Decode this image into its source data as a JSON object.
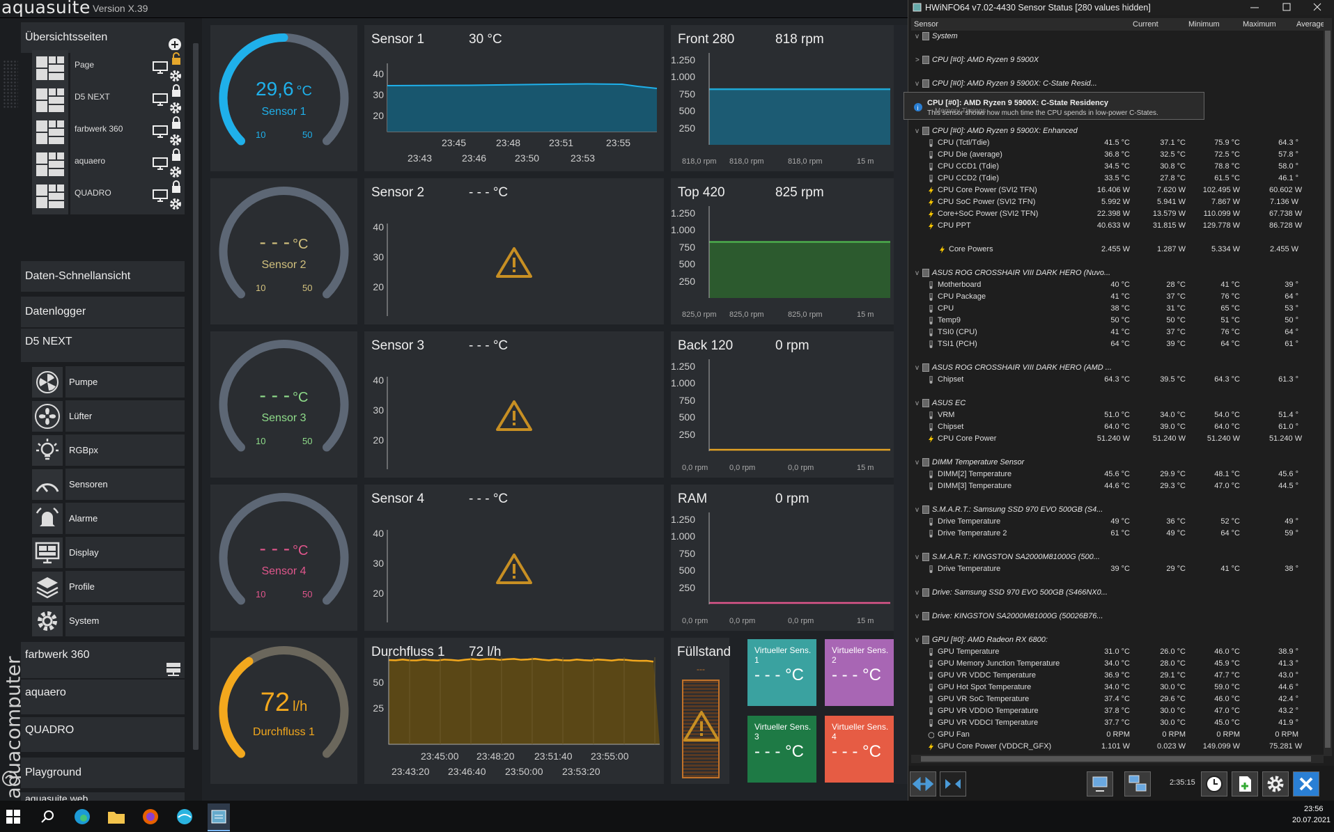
{
  "aquasuite": {
    "logo": "aquasuite",
    "version": "Version X.39",
    "brand_vertical": "aquacomputer",
    "sidebar": {
      "overview": "Übersichtsseiten",
      "pages": [
        {
          "label": "Page",
          "locked": false
        },
        {
          "label": "D5 NEXT",
          "locked": true
        },
        {
          "label": "farbwerk 360",
          "locked": true
        },
        {
          "label": "aquaero",
          "locked": true
        },
        {
          "label": "QUADRO",
          "locked": true
        }
      ],
      "data_quickview": "Daten-Schnellansicht",
      "datalogger": "Datenlogger",
      "d5next": "D5 NEXT",
      "d5_items": [
        "Pumpe",
        "Lüfter",
        "RGBpx",
        "Sensoren",
        "Alarme",
        "Display",
        "Profile",
        "System"
      ],
      "farbwerk": "farbwerk 360",
      "aquaero": "aquaero",
      "quadro": "QUADRO",
      "playground": "Playground",
      "aquasuite_web": "aquasuite web"
    },
    "gauges": [
      {
        "value": "29,6",
        "unit": "°C",
        "name": "Sensor 1",
        "min": "10",
        "max": "50",
        "color": "#1fb0ea",
        "fill": 0.5
      },
      {
        "value": "- - -",
        "unit": "°C",
        "name": "Sensor 2",
        "min": "10",
        "max": "50",
        "color": "#d1c07d",
        "fill": 0
      },
      {
        "value": "- - -",
        "unit": "°C",
        "name": "Sensor 3",
        "min": "10",
        "max": "50",
        "color": "#8fdc8a",
        "fill": 0
      },
      {
        "value": "- - -",
        "unit": "°C",
        "name": "Sensor 4",
        "min": "10",
        "max": "50",
        "color": "#e0568c",
        "fill": 0
      },
      {
        "value": "72",
        "unit": "l/h",
        "name": "Durchfluss 1",
        "color": "#f3a81d",
        "fill": 0.37
      }
    ],
    "temp_charts": [
      {
        "title": "Sensor 1",
        "value": "30 °C",
        "yticks": [
          "40",
          "30",
          "20"
        ],
        "xticks_top": [
          "23:45",
          "23:48",
          "23:51",
          "23:55"
        ],
        "xticks_bottom": [
          "23:43",
          "23:46",
          "23:50",
          "23:53"
        ],
        "has_data": true
      },
      {
        "title": "Sensor 2",
        "value": "- - - °C",
        "yticks": [
          "40",
          "30",
          "20"
        ],
        "has_data": false
      },
      {
        "title": "Sensor 3",
        "value": "- - - °C",
        "yticks": [
          "40",
          "30",
          "20"
        ],
        "has_data": false
      },
      {
        "title": "Sensor 4",
        "value": "- - - °C",
        "yticks": [
          "40",
          "30",
          "20"
        ],
        "has_data": false
      }
    ],
    "flow_chart": {
      "title": "Durchfluss 1",
      "value": "72 l/h",
      "yticks": [
        "50",
        "25"
      ],
      "xticks_top": [
        "23:45:00",
        "23:48:20",
        "23:51:40",
        "23:55:00"
      ],
      "xticks_bottom": [
        "23:43:20",
        "23:46:40",
        "23:50:00",
        "23:53:20"
      ]
    },
    "fan_charts": [
      {
        "title": "Front 280",
        "value": "818 rpm",
        "yticks": [
          "1.250",
          "1.000",
          "750",
          "500",
          "250"
        ],
        "footer": [
          "818,0 rpm",
          "818,0 rpm",
          "818,0 rpm",
          "15 m"
        ],
        "level": 818,
        "color": "#1fa8d6"
      },
      {
        "title": "Top 420",
        "value": "825 rpm",
        "yticks": [
          "1.250",
          "1.000",
          "750",
          "500",
          "250"
        ],
        "footer": [
          "825,0 rpm",
          "825,0 rpm",
          "825,0 rpm",
          "15 m"
        ],
        "level": 825,
        "color": "#4cae4c"
      },
      {
        "title": "Back 120",
        "value": "0 rpm",
        "yticks": [
          "1.250",
          "1.000",
          "750",
          "500",
          "250"
        ],
        "footer": [
          "0,0 rpm",
          "0,0 rpm",
          "0,0 rpm",
          "15 m"
        ],
        "level": 0,
        "color": "#e3a224"
      },
      {
        "title": "RAM",
        "value": "0 rpm",
        "yticks": [
          "1.250",
          "1.000",
          "750",
          "500",
          "250"
        ],
        "footer": [
          "0,0 rpm",
          "0,0 rpm",
          "0,0 rpm",
          "15 m"
        ],
        "level": 0,
        "color": "#e0568c"
      }
    ],
    "fill_level": {
      "title": "Füllstand",
      "value": "---"
    },
    "virtual_sensors": [
      {
        "title": "Virtueller Sens. 1",
        "value": "- - - °C",
        "color": "#3aa2a0"
      },
      {
        "title": "Virtueller Sens. 2",
        "value": "- - - °C",
        "color": "#a866b4"
      },
      {
        "title": "Virtueller Sens. 3",
        "value": "- - - °C",
        "color": "#1e7a45"
      },
      {
        "title": "Virtueller Sens. 4",
        "value": "- - - °C",
        "color": "#e65c44"
      }
    ]
  },
  "hwinfo": {
    "title": "HWiNFO64 v7.02-4430 Sensor Status [280 values hidden]",
    "columns": [
      "Sensor",
      "Current",
      "Minimum",
      "Maximum",
      "Average"
    ],
    "tooltip": {
      "title": "CPU [#0]: AMD Ryzen 9 5900X: C-State Residency",
      "text": "This sensor shows how much time the CPU spends in low-power C-States.",
      "behind": "Memory Timings"
    },
    "rows": [
      {
        "g": "System",
        "exp": "v"
      },
      {
        "g": "",
        "exp": ""
      },
      {
        "g": "CPU [#0]: AMD Ryzen 9 5900X",
        "exp": ">"
      },
      {
        "g": "",
        "exp": ""
      },
      {
        "g": "CPU [#0]: AMD Ryzen 9 5900X: C-State Resid...",
        "exp": "v"
      },
      {
        "g": "",
        "exp": ""
      },
      {
        "g": "",
        "exp": ""
      },
      {
        "g": "",
        "exp": ""
      },
      {
        "g": "CPU [#0]: AMD Ryzen 9 5900X: Enhanced",
        "exp": "v"
      },
      {
        "n": "CPU (Tctl/Tdie)",
        "t": "T",
        "v": [
          "41.5 °C",
          "37.1 °C",
          "75.9 °C",
          "64.3 °"
        ]
      },
      {
        "n": "CPU Die (average)",
        "t": "T",
        "v": [
          "36.8 °C",
          "32.5 °C",
          "72.5 °C",
          "57.8 °"
        ]
      },
      {
        "n": "CPU CCD1 (Tdie)",
        "t": "T",
        "v": [
          "34.5 °C",
          "30.8 °C",
          "78.8 °C",
          "58.0 °"
        ]
      },
      {
        "n": "CPU CCD2 (Tdie)",
        "t": "T",
        "v": [
          "33.5 °C",
          "27.8 °C",
          "61.5 °C",
          "46.1 °"
        ]
      },
      {
        "n": "CPU Core Power (SVI2 TFN)",
        "t": "P",
        "v": [
          "16.406 W",
          "7.620 W",
          "102.495 W",
          "60.602 W"
        ]
      },
      {
        "n": "CPU SoC Power (SVI2 TFN)",
        "t": "P",
        "v": [
          "5.992 W",
          "5.941 W",
          "7.867 W",
          "7.136 W"
        ]
      },
      {
        "n": "Core+SoC Power (SVI2 TFN)",
        "t": "P",
        "v": [
          "22.398 W",
          "13.579 W",
          "110.099 W",
          "67.738 W"
        ]
      },
      {
        "n": "CPU PPT",
        "t": "P",
        "v": [
          "40.633 W",
          "31.815 W",
          "129.778 W",
          "86.728 W"
        ]
      },
      {
        "g": "",
        "exp": ""
      },
      {
        "n": "Core Powers",
        "t": "P",
        "v": [
          "2.455 W",
          "1.287 W",
          "5.334 W",
          "2.455 W"
        ],
        "indent": true
      },
      {
        "g": "",
        "exp": ""
      },
      {
        "g": "ASUS ROG CROSSHAIR VIII DARK HERO (Nuvo...",
        "exp": "v"
      },
      {
        "n": "Motherboard",
        "t": "T",
        "v": [
          "40 °C",
          "28 °C",
          "41 °C",
          "39 °"
        ]
      },
      {
        "n": "CPU Package",
        "t": "T",
        "v": [
          "41 °C",
          "37 °C",
          "76 °C",
          "64 °"
        ]
      },
      {
        "n": "CPU",
        "t": "T",
        "v": [
          "38 °C",
          "31 °C",
          "65 °C",
          "53 °"
        ]
      },
      {
        "n": "Temp9",
        "t": "T",
        "v": [
          "50 °C",
          "50 °C",
          "51 °C",
          "50 °"
        ]
      },
      {
        "n": "TSI0 (CPU)",
        "t": "T",
        "v": [
          "41 °C",
          "37 °C",
          "76 °C",
          "64 °"
        ]
      },
      {
        "n": "TSI1 (PCH)",
        "t": "T",
        "v": [
          "64 °C",
          "39 °C",
          "64 °C",
          "61 °"
        ]
      },
      {
        "g": "",
        "exp": ""
      },
      {
        "g": "ASUS ROG CROSSHAIR VIII DARK HERO (AMD ...",
        "exp": "v"
      },
      {
        "n": "Chipset",
        "t": "T",
        "v": [
          "64.3 °C",
          "39.5 °C",
          "64.3 °C",
          "61.3 °"
        ]
      },
      {
        "g": "",
        "exp": ""
      },
      {
        "g": "ASUS EC",
        "exp": "v"
      },
      {
        "n": "VRM",
        "t": "T",
        "v": [
          "51.0 °C",
          "34.0 °C",
          "54.0 °C",
          "51.4 °"
        ]
      },
      {
        "n": "Chipset",
        "t": "T",
        "v": [
          "64.0 °C",
          "39.0 °C",
          "64.0 °C",
          "61.0 °"
        ]
      },
      {
        "n": "CPU Core Power",
        "t": "P",
        "v": [
          "51.240 W",
          "51.240 W",
          "51.240 W",
          "51.240 W"
        ]
      },
      {
        "g": "",
        "exp": ""
      },
      {
        "g": "DIMM Temperature Sensor",
        "exp": "v"
      },
      {
        "n": "DIMM[2] Temperature",
        "t": "T",
        "v": [
          "45.6 °C",
          "29.9 °C",
          "48.1 °C",
          "45.6 °"
        ]
      },
      {
        "n": "DIMM[3] Temperature",
        "t": "T",
        "v": [
          "44.6 °C",
          "29.3 °C",
          "47.0 °C",
          "44.5 °"
        ]
      },
      {
        "g": "",
        "exp": ""
      },
      {
        "g": "S.M.A.R.T.: Samsung SSD 970 EVO 500GB (S4...",
        "exp": "v"
      },
      {
        "n": "Drive Temperature",
        "t": "T",
        "v": [
          "49 °C",
          "36 °C",
          "52 °C",
          "49 °"
        ]
      },
      {
        "n": "Drive Temperature 2",
        "t": "T",
        "v": [
          "61 °C",
          "49 °C",
          "64 °C",
          "59 °"
        ]
      },
      {
        "g": "",
        "exp": ""
      },
      {
        "g": "S.M.A.R.T.: KINGSTON SA2000M81000G (500...",
        "exp": "v"
      },
      {
        "n": "Drive Temperature",
        "t": "T",
        "v": [
          "39 °C",
          "29 °C",
          "41 °C",
          "38 °"
        ]
      },
      {
        "g": "",
        "exp": ""
      },
      {
        "g": "Drive: Samsung SSD 970 EVO 500GB (S466NX0...",
        "exp": "v"
      },
      {
        "g": "",
        "exp": ""
      },
      {
        "g": "Drive: KINGSTON SA2000M81000G (50026B76...",
        "exp": "v"
      },
      {
        "g": "",
        "exp": ""
      },
      {
        "g": "GPU [#0]: AMD Radeon RX 6800:",
        "exp": "v"
      },
      {
        "n": "GPU Temperature",
        "t": "T",
        "v": [
          "31.0 °C",
          "26.0 °C",
          "46.0 °C",
          "38.9 °"
        ]
      },
      {
        "n": "GPU Memory Junction Temperature",
        "t": "T",
        "v": [
          "34.0 °C",
          "28.0 °C",
          "45.9 °C",
          "41.3 °"
        ]
      },
      {
        "n": "GPU VR VDDC Temperature",
        "t": "T",
        "v": [
          "36.9 °C",
          "29.1 °C",
          "47.7 °C",
          "43.0 °"
        ]
      },
      {
        "n": "GPU Hot Spot Temperature",
        "t": "T",
        "v": [
          "34.0 °C",
          "30.0 °C",
          "59.0 °C",
          "44.6 °"
        ]
      },
      {
        "n": "GPU VR SoC Temperature",
        "t": "T",
        "v": [
          "37.4 °C",
          "29.6 °C",
          "46.0 °C",
          "42.4 °"
        ]
      },
      {
        "n": "GPU VR VDDIO Temperature",
        "t": "T",
        "v": [
          "37.8 °C",
          "30.0 °C",
          "47.0 °C",
          "43.2 °"
        ]
      },
      {
        "n": "GPU VR VDDCI Temperature",
        "t": "T",
        "v": [
          "37.7 °C",
          "30.0 °C",
          "45.0 °C",
          "41.9 °"
        ]
      },
      {
        "n": "GPU Fan",
        "t": "F",
        "v": [
          "0 RPM",
          "0 RPM",
          "0 RPM",
          "0 RPM"
        ]
      },
      {
        "n": "GPU Core Power (VDDCR_GFX)",
        "t": "P",
        "v": [
          "1.101 W",
          "0.023 W",
          "149.099 W",
          "75.281 W"
        ]
      }
    ],
    "clock": "2:35:15"
  },
  "taskbar": {
    "time": "23:56",
    "date": "20.07.2021"
  }
}
